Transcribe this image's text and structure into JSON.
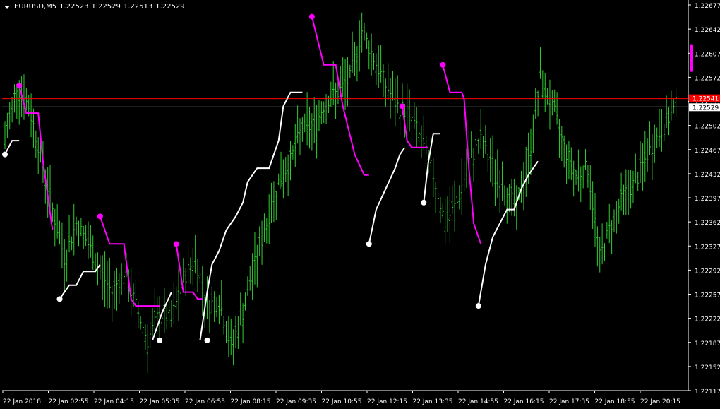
{
  "header": {
    "symbol": "EURUSD,M5",
    "open": "1.22523",
    "high": "1.22529",
    "low": "1.22513",
    "close": "1.22529"
  },
  "price_lines": {
    "ask": "1.22541",
    "bid": "1.22529"
  },
  "colors": {
    "background": "#000000",
    "bars": "#32cd32",
    "trail_up": "#ffffff",
    "trail_down": "#ff00ff",
    "ask_line": "#ff0000",
    "bid_line": "#808080",
    "axis_text": "#ffffff"
  },
  "chart_data": {
    "type": "ohlc",
    "y_tick_labels": [
      "1.22677",
      "1.22642",
      "1.22607",
      "1.22572",
      "1.22537",
      "1.22502",
      "1.22467",
      "1.22432",
      "1.22397",
      "1.22362",
      "1.22327",
      "1.22292",
      "1.22257",
      "1.22222",
      "1.22187",
      "1.22152",
      "1.22117"
    ],
    "ylim": [
      1.22117,
      1.22677
    ],
    "x_tick_labels": [
      "22 Jan 2018",
      "22 Jan 02:55",
      "22 Jan 04:15",
      "22 Jan 05:35",
      "22 Jan 06:55",
      "22 Jan 08:15",
      "22 Jan 09:35",
      "22 Jan 10:55",
      "22 Jan 12:15",
      "22 Jan 13:35",
      "22 Jan 14:55",
      "22 Jan 16:15",
      "22 Jan 17:35",
      "22 Jan 18:55",
      "22 Jan 20:15"
    ],
    "price_path": [
      [
        0,
        1.2248
      ],
      [
        5,
        1.2256
      ],
      [
        10,
        1.2253
      ],
      [
        15,
        1.2246
      ],
      [
        20,
        1.2238
      ],
      [
        25,
        1.2231
      ],
      [
        30,
        1.2236
      ],
      [
        35,
        1.2233
      ],
      [
        40,
        1.2229
      ],
      [
        45,
        1.2226
      ],
      [
        50,
        1.2229
      ],
      [
        55,
        1.2224
      ],
      [
        60,
        1.2219
      ],
      [
        65,
        1.2223
      ],
      [
        70,
        1.2222
      ],
      [
        75,
        1.2228
      ],
      [
        80,
        1.2231
      ],
      [
        85,
        1.2224
      ],
      [
        90,
        1.2225
      ],
      [
        95,
        1.2218
      ],
      [
        100,
        1.2223
      ],
      [
        105,
        1.223
      ],
      [
        110,
        1.2236
      ],
      [
        115,
        1.2242
      ],
      [
        120,
        1.2245
      ],
      [
        125,
        1.225
      ],
      [
        130,
        1.225
      ],
      [
        135,
        1.2254
      ],
      [
        140,
        1.2255
      ],
      [
        145,
        1.2257
      ],
      [
        150,
        1.2264
      ],
      [
        155,
        1.226
      ],
      [
        160,
        1.2256
      ],
      [
        165,
        1.2253
      ],
      [
        170,
        1.2252
      ],
      [
        175,
        1.2248
      ],
      [
        180,
        1.2243
      ],
      [
        185,
        1.2236
      ],
      [
        190,
        1.2239
      ],
      [
        195,
        1.2245
      ],
      [
        200,
        1.2248
      ],
      [
        205,
        1.2244
      ],
      [
        210,
        1.2241
      ],
      [
        215,
        1.2238
      ],
      [
        220,
        1.2245
      ],
      [
        225,
        1.2257
      ],
      [
        230,
        1.2253
      ],
      [
        235,
        1.2247
      ],
      [
        240,
        1.2243
      ],
      [
        245,
        1.2244
      ],
      [
        250,
        1.2231
      ],
      [
        255,
        1.2236
      ],
      [
        260,
        1.224
      ],
      [
        265,
        1.2242
      ],
      [
        270,
        1.2246
      ],
      [
        275,
        1.2249
      ],
      [
        282,
        1.2253
      ]
    ],
    "trail_up": [
      [
        [
          0,
          1.2246
        ],
        [
          3,
          1.2248
        ],
        [
          6,
          1.2248
        ]
      ],
      [
        [
          23,
          1.2225
        ],
        [
          27,
          1.2227
        ],
        [
          30,
          1.2227
        ],
        [
          33,
          1.2229
        ],
        [
          38,
          1.2229
        ],
        [
          40,
          1.223
        ]
      ],
      [
        [
          62,
          1.2219
        ],
        [
          66,
          1.2223
        ],
        [
          70,
          1.2226
        ]
      ],
      [
        [
          82,
          1.2219
        ],
        [
          85,
          1.2226
        ],
        [
          87,
          1.223
        ],
        [
          90,
          1.2232
        ],
        [
          93,
          1.2235
        ],
        [
          97,
          1.2237
        ],
        [
          100,
          1.2239
        ],
        [
          102,
          1.2242
        ],
        [
          106,
          1.2244
        ],
        [
          111,
          1.2244
        ],
        [
          115,
          1.2248
        ],
        [
          117,
          1.2253
        ],
        [
          120,
          1.2255
        ],
        [
          125,
          1.2255
        ]
      ],
      [
        [
          153,
          1.2233
        ],
        [
          156,
          1.2238
        ],
        [
          160,
          1.2241
        ],
        [
          164,
          1.2244
        ],
        [
          166,
          1.2246
        ],
        [
          168,
          1.2247
        ]
      ],
      [
        [
          176,
          1.2239
        ],
        [
          178,
          1.2245
        ],
        [
          180,
          1.2249
        ],
        [
          183,
          1.2249
        ]
      ],
      [
        [
          199,
          1.2224
        ],
        [
          202,
          1.223
        ],
        [
          205,
          1.2234
        ],
        [
          208,
          1.2236
        ],
        [
          211,
          1.2238
        ],
        [
          214,
          1.2238
        ],
        [
          217,
          1.2241
        ],
        [
          220,
          1.2243
        ],
        [
          224,
          1.2245
        ]
      ]
    ],
    "trail_down": [
      [
        [
          6,
          1.2256
        ],
        [
          9,
          1.2252
        ],
        [
          14,
          1.2252
        ],
        [
          16,
          1.2245
        ],
        [
          20,
          1.2235
        ]
      ],
      [
        [
          40,
          1.2237
        ],
        [
          44,
          1.2233
        ],
        [
          50,
          1.2233
        ],
        [
          53,
          1.2225
        ],
        [
          55,
          1.2224
        ],
        [
          65,
          1.2224
        ]
      ],
      [
        [
          72,
          1.2233
        ],
        [
          75,
          1.2226
        ],
        [
          79,
          1.2226
        ],
        [
          81,
          1.2225
        ],
        [
          83,
          1.2225
        ]
      ],
      [
        [
          129,
          1.2266
        ],
        [
          134,
          1.2259
        ],
        [
          139,
          1.2259
        ],
        [
          142,
          1.2253
        ],
        [
          147,
          1.2246
        ],
        [
          151,
          1.2243
        ],
        [
          153,
          1.2243
        ]
      ],
      [
        [
          167,
          1.2253
        ],
        [
          169,
          1.2248
        ],
        [
          171,
          1.2247
        ],
        [
          178,
          1.2247
        ]
      ],
      [
        [
          184,
          1.2259
        ],
        [
          187,
          1.2255
        ],
        [
          192,
          1.2255
        ],
        [
          193,
          1.2254
        ],
        [
          195,
          1.2244
        ],
        [
          197,
          1.2236
        ],
        [
          200,
          1.2233
        ]
      ]
    ],
    "trail_dots_up": [
      [
        0,
        1.2246
      ],
      [
        23,
        1.2225
      ],
      [
        65,
        1.2219
      ],
      [
        85,
        1.2219
      ],
      [
        153,
        1.2233
      ],
      [
        176,
        1.2239
      ],
      [
        199,
        1.2224
      ]
    ],
    "trail_dots_down": [
      [
        6,
        1.2256
      ],
      [
        40,
        1.2237
      ],
      [
        72,
        1.2233
      ],
      [
        129,
        1.2266
      ],
      [
        167,
        1.2253
      ],
      [
        184,
        1.2259
      ]
    ]
  }
}
